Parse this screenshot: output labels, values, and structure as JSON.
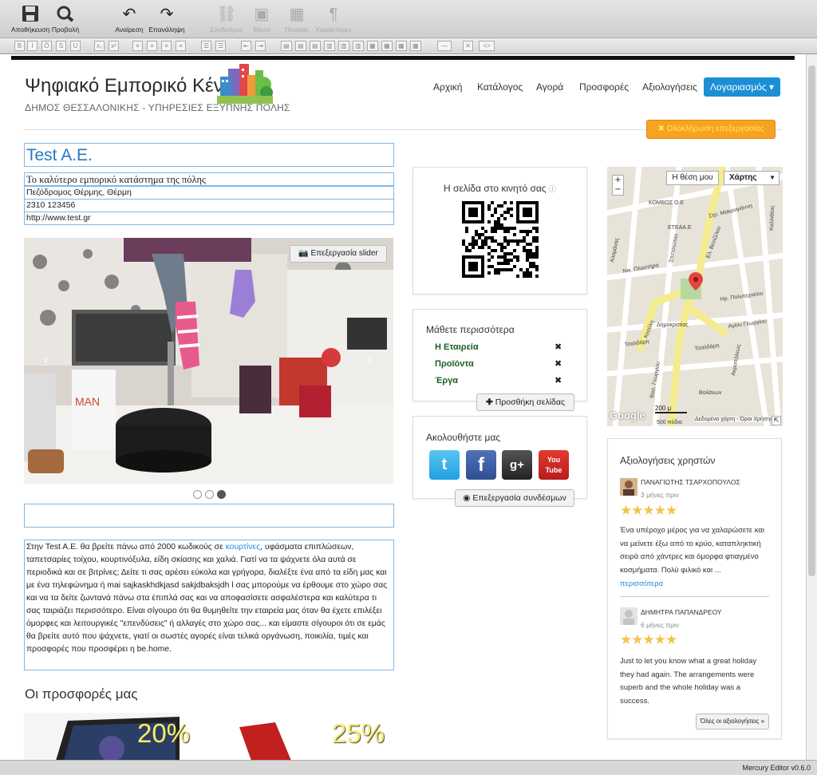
{
  "toolbar": {
    "save": "Αποθήκευση",
    "preview": "Προβολή",
    "undo": "Αναίρεση",
    "redo": "Επανάληψη",
    "link": "Σύνδεσμος",
    "media": "Μέσα",
    "table": "Πίνακας",
    "chars": "Χαρακτήρες"
  },
  "header": {
    "site_title": "Ψηφιακό Εμπορικό Κέντρο",
    "subtitle": "ΔΗΜΟΣ ΘΕΣΣΑΛΟΝΙΚΗΣ - ΥΠΗΡΕΣΙΕΣ ΕΞΥΠΝΗΣ ΠΟΛΗΣ",
    "nav": [
      "Αρχική",
      "Κατάλογος",
      "Αγορά",
      "Προσφορές",
      "Αξιολογήσεις"
    ],
    "account": "Λογαριασμός ▾",
    "finish_edit": "✖ Ολοκλήρωση επεξεργασίας"
  },
  "company": {
    "name": "Test A.E.",
    "slogan": "Το καλύτερο εμπορικό κατάστημα της πόλης",
    "address": "Πεζόδρομος Θέρμης, Θέρμη",
    "phone": "2310 123456",
    "website": "http://www.test.gr"
  },
  "slider": {
    "edit_label": "Επεξεργασία slider",
    "dots": 3,
    "active_dot": 3
  },
  "description": {
    "part1": "Στην Test A.E. θα βρείτε πάνω από 2000 κωδικούς σε ",
    "link": "κουρτίνες",
    "part2": ", υφάσματα επιπλώσεων, ταπετσαρίες τοίχου, κουρτινόξυλα, είδη σκίασης και χαλιά. Γιατί να τα ψάχνετε όλα αυτά σε περιοδικά και σε βιτρίνες; Δείτε τι σας αρέσει εύκολα και γρήγορα, διαλέξτε ένα από τα είδη μας και με ένα τηλεφώνημα ή mai sajkaskhdkjasd  sakjdbaksjdh l σας μπορούμε να έρθουμε στο χώρο σας και να τα δείτε ζωντανά πάνω στα έπιπλά σας και να αποφασίσετε ασφαλέστερα και καλύτερα τι σας ταιριάζει περισσότερο. Είναι σίγουρο ότι θα θυμηθείτε την εταιρεία μας όταν θα έχετε επιλέξει όμορφες και λειτουργικές \"επενδύσεις\" ή αλλαγές στο χώρο σας... και είμαστε σίγουροι ότι σε εμάς θα βρείτε αυτό που ψάχνετε, γιατί οι σωστές αγορές είναι τελικά οργάνωση, ποικιλία, τιμές και προσφορές που προσφέρει η be.home."
  },
  "offers": {
    "title": "Οι προσφορές μας",
    "items": [
      {
        "pct": "20%"
      },
      {
        "pct": "25%"
      }
    ]
  },
  "qr_panel": {
    "title": "Η σελίδα στο κινητό σας"
  },
  "more_panel": {
    "title": "Μάθετε περισσότερα",
    "links": [
      "Η Εταιρεία",
      "Προϊόντα",
      "Έργα"
    ],
    "add_page": "Προσθήκη σελίδας"
  },
  "follow_panel": {
    "title": "Ακολουθήστε μας",
    "edit_links": "Επεξεργασία συνδέσμων"
  },
  "map": {
    "my_location": "Η θέση μου",
    "map_type": "Χάρτης",
    "scale_m": "200 μ",
    "scale_ft": "500 πόδια",
    "map_data": "Δεδομένα χάρτη",
    "terms": "Όροι Χρήσης",
    "google": "Google",
    "streets": [
      "ΚΟΜΒΟΣ Ο.Ε",
      "ΕΤΕΑΑ.Ε",
      "Στρ. Μακρυγιάννη",
      "Ελ. Βενιζέλου",
      "Ηρ. Πολυτεχνείου",
      "Αγίου Γεωργίου",
      "Τσαλδάρη",
      "Κεσύλη",
      "Αλαμάνας",
      "Σπετσιώτου",
      "Δημοκρατίας",
      "Βασ. Γεωργίου",
      "Ακροπόλεως",
      "Νικ. Πλαστήρα",
      "Βολάνων",
      "Καλλιθέας"
    ]
  },
  "reviews": {
    "title": "Αξιολογήσεις χρηστών",
    "items": [
      {
        "name": "ΠΑΝΑΓΙΩΤΗΣ ΤΣΑΡΧΟΠΟΥΛΟΣ",
        "date": "3 μήνες πριν",
        "stars": "★★★★★",
        "text": "Ένα υπέροχο μέρος για να χαλαρώσετε και να μείνετε έξω από το κρύο, καταπληκτική σειρά από χάντρες και όμορφα φτιαγμένο κοσμήματα. Πολύ φιλικό και ...",
        "more": "περισσότερα"
      },
      {
        "name": "ΔΗΜΗΤΡΑ ΠΑΠΑΝΔΡΕΟΥ",
        "date": "6 μήνες πριν",
        "stars": "★★★★★",
        "text": "Just to let you know what a great holiday they had again. The arrangements were superb and the whole holiday was a success."
      }
    ],
    "all_reviews": "Όλες οι αξιολογήσεις »"
  },
  "status": "Mercury Editor v0.6.0"
}
